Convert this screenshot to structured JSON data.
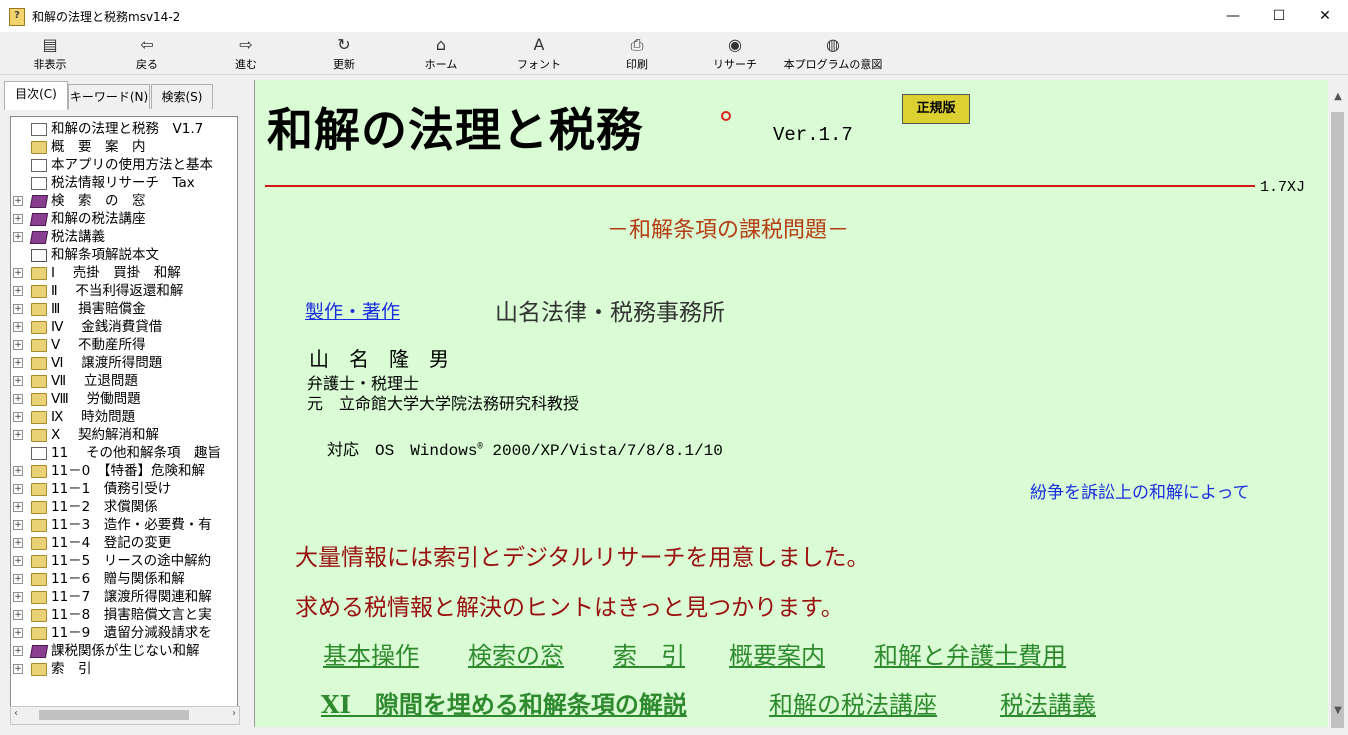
{
  "window": {
    "title": "和解の法理と税務msv14-2",
    "minimize": "—",
    "maximize": "☐",
    "close": "✕"
  },
  "toolbar": [
    {
      "label": "非表示",
      "icon": "hide-icon",
      "glyph": "▤"
    },
    {
      "label": "戻る",
      "icon": "back-arrow-icon",
      "glyph": "⇦"
    },
    {
      "label": "進む",
      "icon": "forward-arrow-icon",
      "glyph": "⇨"
    },
    {
      "label": "更新",
      "icon": "refresh-icon",
      "glyph": "↻"
    },
    {
      "label": "ホーム",
      "icon": "home-icon",
      "glyph": "⌂"
    },
    {
      "label": "フォント",
      "icon": "font-icon",
      "glyph": "A"
    },
    {
      "label": "印刷",
      "icon": "print-icon",
      "glyph": "⎙"
    },
    {
      "label": "リサーチ",
      "icon": "research-icon",
      "glyph": "◉"
    },
    {
      "label": "本プログラムの意図",
      "icon": "intent-icon",
      "glyph": "◍"
    }
  ],
  "tabs": [
    "目次(C)",
    "キーワード(N)",
    "検索(S)"
  ],
  "tree": [
    {
      "label": "和解の法理と税務　V1.7",
      "icon": "page",
      "exp": false
    },
    {
      "label": "概　要　案　内",
      "icon": "folder",
      "exp": false
    },
    {
      "label": "本アプリの使用方法と基本",
      "icon": "page",
      "exp": false
    },
    {
      "label": "税法情報リサーチ　Tax",
      "icon": "page",
      "exp": false
    },
    {
      "label": "検　索　の　窓",
      "icon": "book",
      "exp": true
    },
    {
      "label": "和解の税法講座",
      "icon": "book",
      "exp": true
    },
    {
      "label": "税法講義",
      "icon": "book",
      "exp": true
    },
    {
      "label": "和解条項解説本文",
      "icon": "doc",
      "exp": false
    },
    {
      "label": "Ⅰ　 売掛　買掛　和解",
      "icon": "folder",
      "exp": true
    },
    {
      "label": "Ⅱ　 不当利得返還和解",
      "icon": "folder",
      "exp": true
    },
    {
      "label": "Ⅲ　 損害賠償金",
      "icon": "folder",
      "exp": true
    },
    {
      "label": "Ⅳ　 金銭消費貸借",
      "icon": "folder",
      "exp": true
    },
    {
      "label": "Ⅴ　 不動産所得",
      "icon": "folder",
      "exp": true
    },
    {
      "label": "Ⅵ　 譲渡所得問題",
      "icon": "folder",
      "exp": true
    },
    {
      "label": "Ⅶ　 立退問題",
      "icon": "folder",
      "exp": true
    },
    {
      "label": "Ⅷ　 労働問題",
      "icon": "folder",
      "exp": true
    },
    {
      "label": "Ⅸ　 時効問題",
      "icon": "folder",
      "exp": true
    },
    {
      "label": "Ⅹ　 契約解消和解",
      "icon": "folder",
      "exp": true
    },
    {
      "label": "11　 その他和解条項　趣旨",
      "icon": "page",
      "exp": false
    },
    {
      "label": "11－0　【特番】危険和解",
      "icon": "folder",
      "exp": true
    },
    {
      "label": "11－1　債務引受け",
      "icon": "folder",
      "exp": true
    },
    {
      "label": "11－2　求償関係",
      "icon": "folder",
      "exp": true
    },
    {
      "label": "11－3　造作・必要費・有",
      "icon": "folder",
      "exp": true
    },
    {
      "label": "11－4　登記の変更",
      "icon": "folder",
      "exp": true
    },
    {
      "label": "11－5　リースの途中解約",
      "icon": "folder",
      "exp": true
    },
    {
      "label": "11－6　贈与関係和解",
      "icon": "folder",
      "exp": true
    },
    {
      "label": "11－7　譲渡所得関連和解",
      "icon": "folder",
      "exp": true
    },
    {
      "label": "11－8　損害賠償文言と実",
      "icon": "folder",
      "exp": true
    },
    {
      "label": "11－9　遺留分減殺請求を",
      "icon": "folder",
      "exp": true
    },
    {
      "label": "課税関係が生じない和解",
      "icon": "book",
      "exp": true
    },
    {
      "label": "索　引",
      "icon": "folder",
      "exp": true
    }
  ],
  "content": {
    "title": "和解の法理と税務",
    "version": "Ver.1.7",
    "edition": "正規版",
    "build": "1.7XJ",
    "subtitle": "－和解条項の課税問題－",
    "author_link": "製作・著作",
    "firm": "山名法律・税務事務所",
    "author": "山名隆男",
    "role1": "弁護士・税理士",
    "role2": "元　立命館大学大学院法務研究科教授",
    "os_prefix": "対応　OS　Windows",
    "os_reg": "®",
    "os_versions": " 2000/XP/Vista/7/8/8.1/10",
    "blue_note": "紛争を訴訟上の和解によって",
    "promo1": "大量情報には索引とデジタルリサーチを用意しました。",
    "promo2": "求める税情報と解決のヒントはきっと見つかります。",
    "links_row1": [
      "基本操作",
      "検索の窓",
      "索　引",
      "概要案内",
      "和解と弁護士費用"
    ],
    "links_row2": [
      "XI　隙間を埋める和解条項の解説",
      "和解の税法講座",
      "税法講義"
    ]
  }
}
